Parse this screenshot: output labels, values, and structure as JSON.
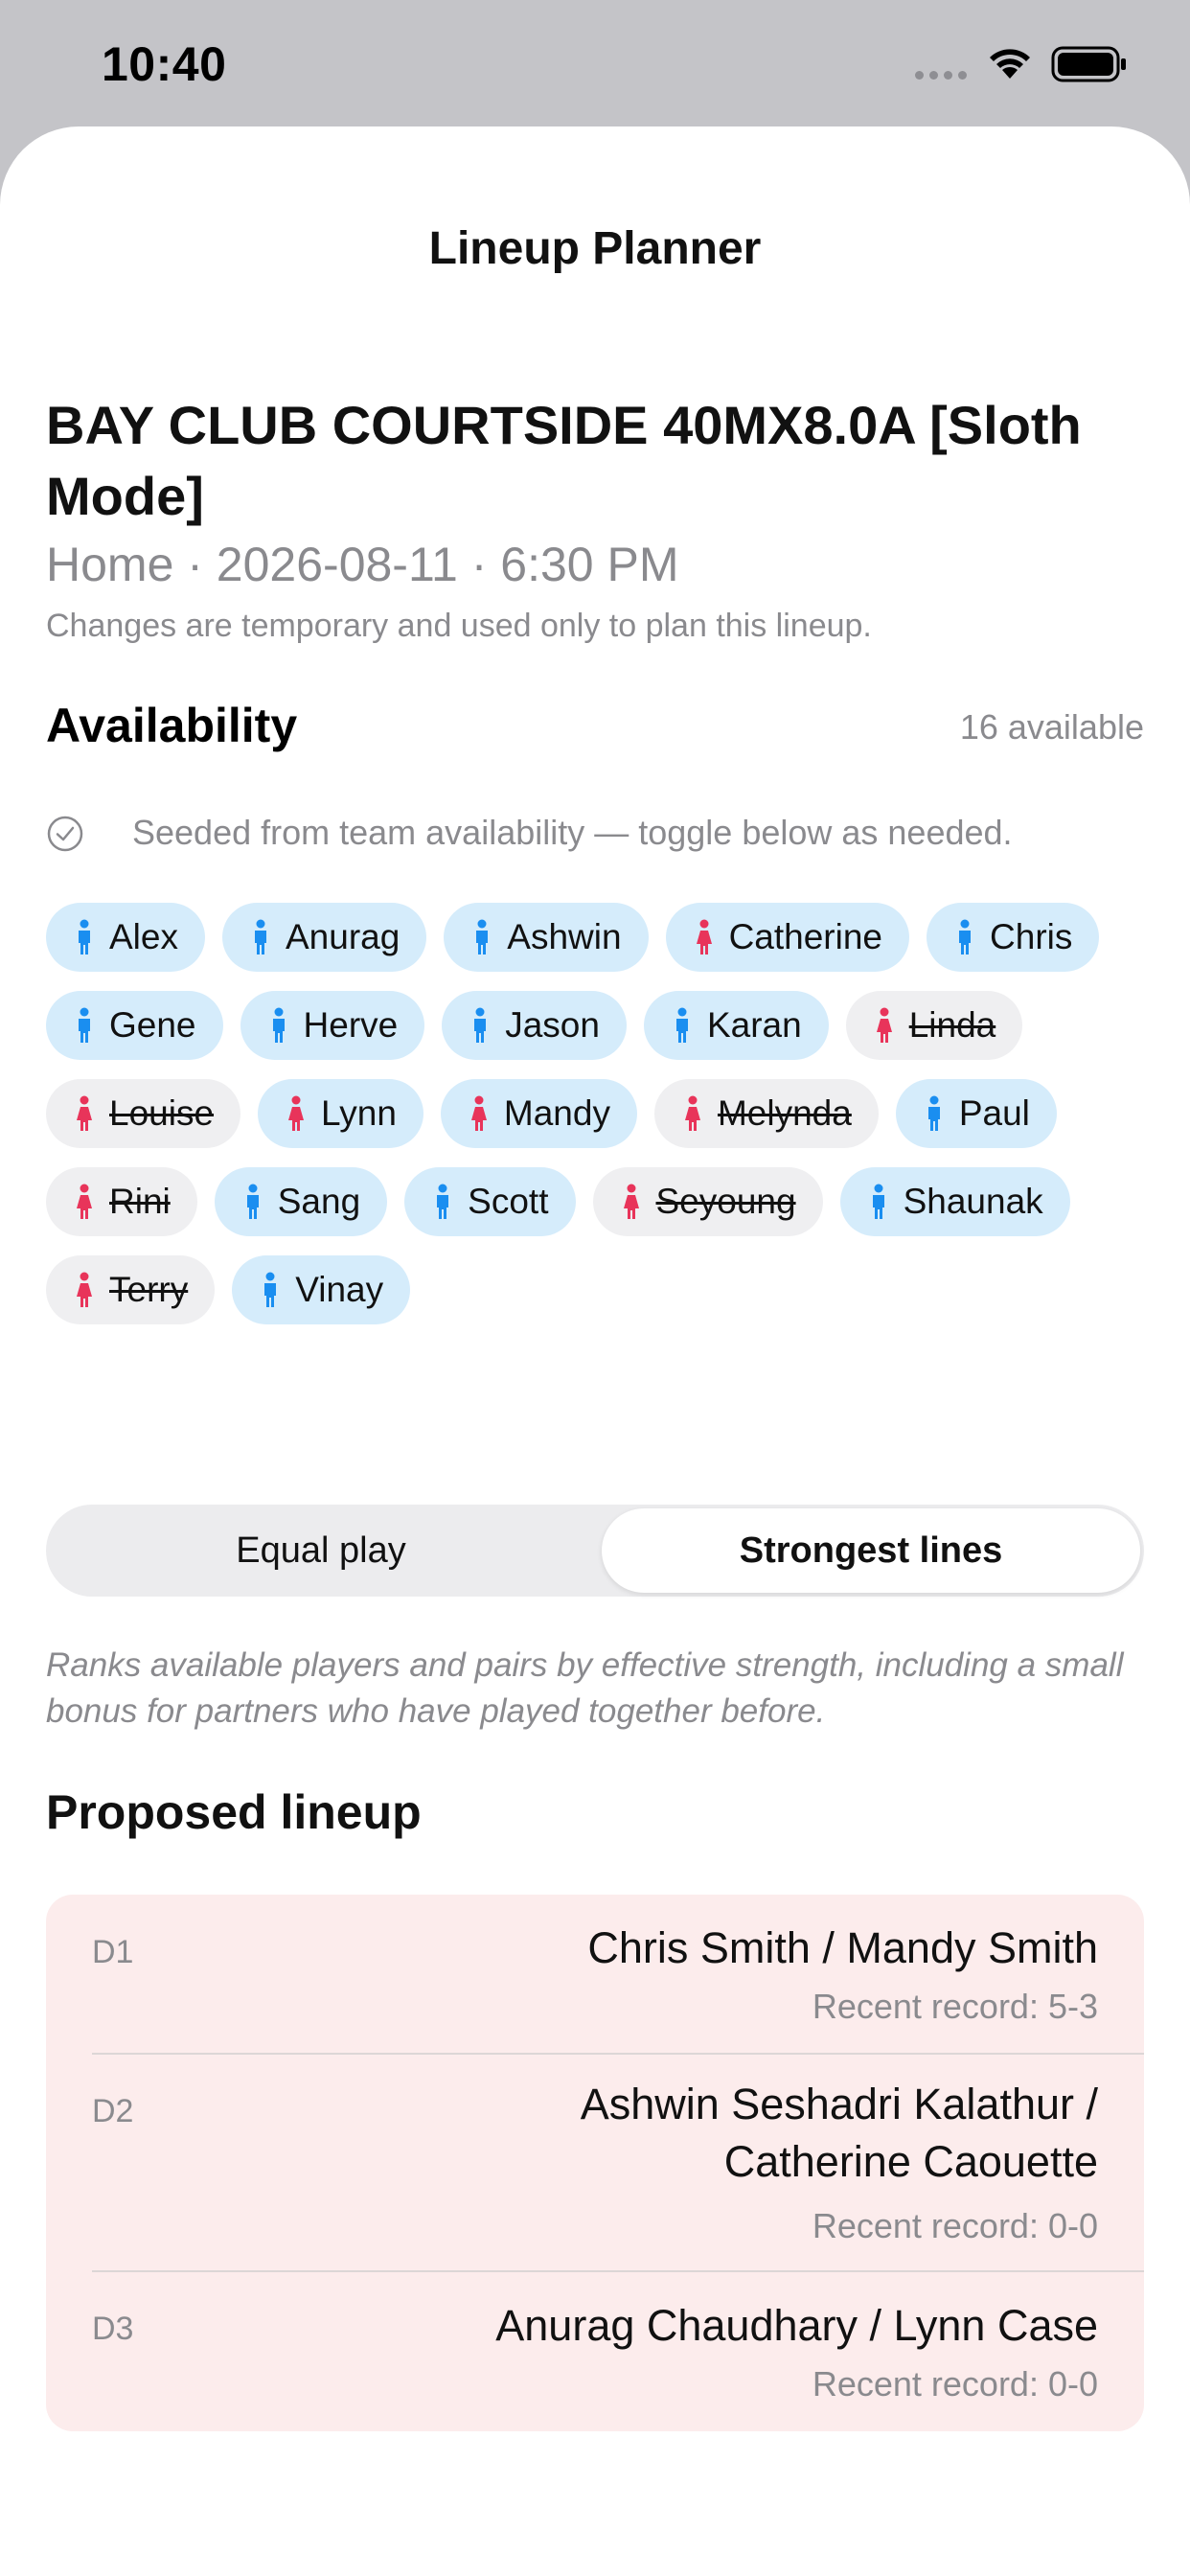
{
  "status_bar": {
    "time": "10:40"
  },
  "nav": {
    "title": "Lineup Planner"
  },
  "match": {
    "title": "BAY CLUB COURTSIDE 40MX8.0A [Sloth Mode]",
    "subtitle": "Home · 2026-08-11 · 6:30 PM",
    "note": "Changes are temporary and used only to plan this lineup."
  },
  "availability": {
    "title": "Availability",
    "count": "16 available",
    "seed_text": "Seeded from team availability — toggle below as needed.",
    "players": [
      {
        "name": "Alex",
        "gender": "male",
        "available": true
      },
      {
        "name": "Anurag",
        "gender": "male",
        "available": true
      },
      {
        "name": "Ashwin",
        "gender": "male",
        "available": true
      },
      {
        "name": "Catherine",
        "gender": "female",
        "available": true
      },
      {
        "name": "Chris",
        "gender": "male",
        "available": true
      },
      {
        "name": "Gene",
        "gender": "male",
        "available": true
      },
      {
        "name": "Herve",
        "gender": "male",
        "available": true
      },
      {
        "name": "Jason",
        "gender": "male",
        "available": true
      },
      {
        "name": "Karan",
        "gender": "male",
        "available": true
      },
      {
        "name": "Linda",
        "gender": "female",
        "available": false
      },
      {
        "name": "Louise",
        "gender": "female",
        "available": false
      },
      {
        "name": "Lynn",
        "gender": "female",
        "available": true
      },
      {
        "name": "Mandy",
        "gender": "female",
        "available": true
      },
      {
        "name": "Melynda",
        "gender": "female",
        "available": false
      },
      {
        "name": "Paul",
        "gender": "male",
        "available": true
      },
      {
        "name": "Rini",
        "gender": "female",
        "available": false
      },
      {
        "name": "Sang",
        "gender": "male",
        "available": true
      },
      {
        "name": "Scott",
        "gender": "male",
        "available": true
      },
      {
        "name": "Seyoung",
        "gender": "female",
        "available": false
      },
      {
        "name": "Shaunak",
        "gender": "male",
        "available": true
      },
      {
        "name": "Terry",
        "gender": "female",
        "available": false
      },
      {
        "name": "Vinay",
        "gender": "male",
        "available": true
      }
    ]
  },
  "mode": {
    "options": [
      "Equal play",
      "Strongest lines"
    ],
    "selected": "Strongest lines",
    "explanation": "Ranks available players and pairs by effective strength, including a small bonus for partners who have played together before."
  },
  "lineup": {
    "title": "Proposed lineup",
    "lines": [
      {
        "court": "D1",
        "players": "Chris Smith / Mandy Smith",
        "record": "Recent record: 5-3"
      },
      {
        "court": "D2",
        "players": "Ashwin Seshadri Kalathur / Catherine Caouette",
        "record": "Recent record: 0-0"
      },
      {
        "court": "D3",
        "players": "Anurag Chaudhary / Lynn Case",
        "record": "Recent record: 0-0"
      }
    ]
  },
  "colors": {
    "male_icon": "#1a8ef0",
    "female_icon": "#e8345a",
    "chip_available": "#d5ecfb",
    "chip_unavailable": "#efeff1",
    "lineup_card": "#fcecec"
  }
}
